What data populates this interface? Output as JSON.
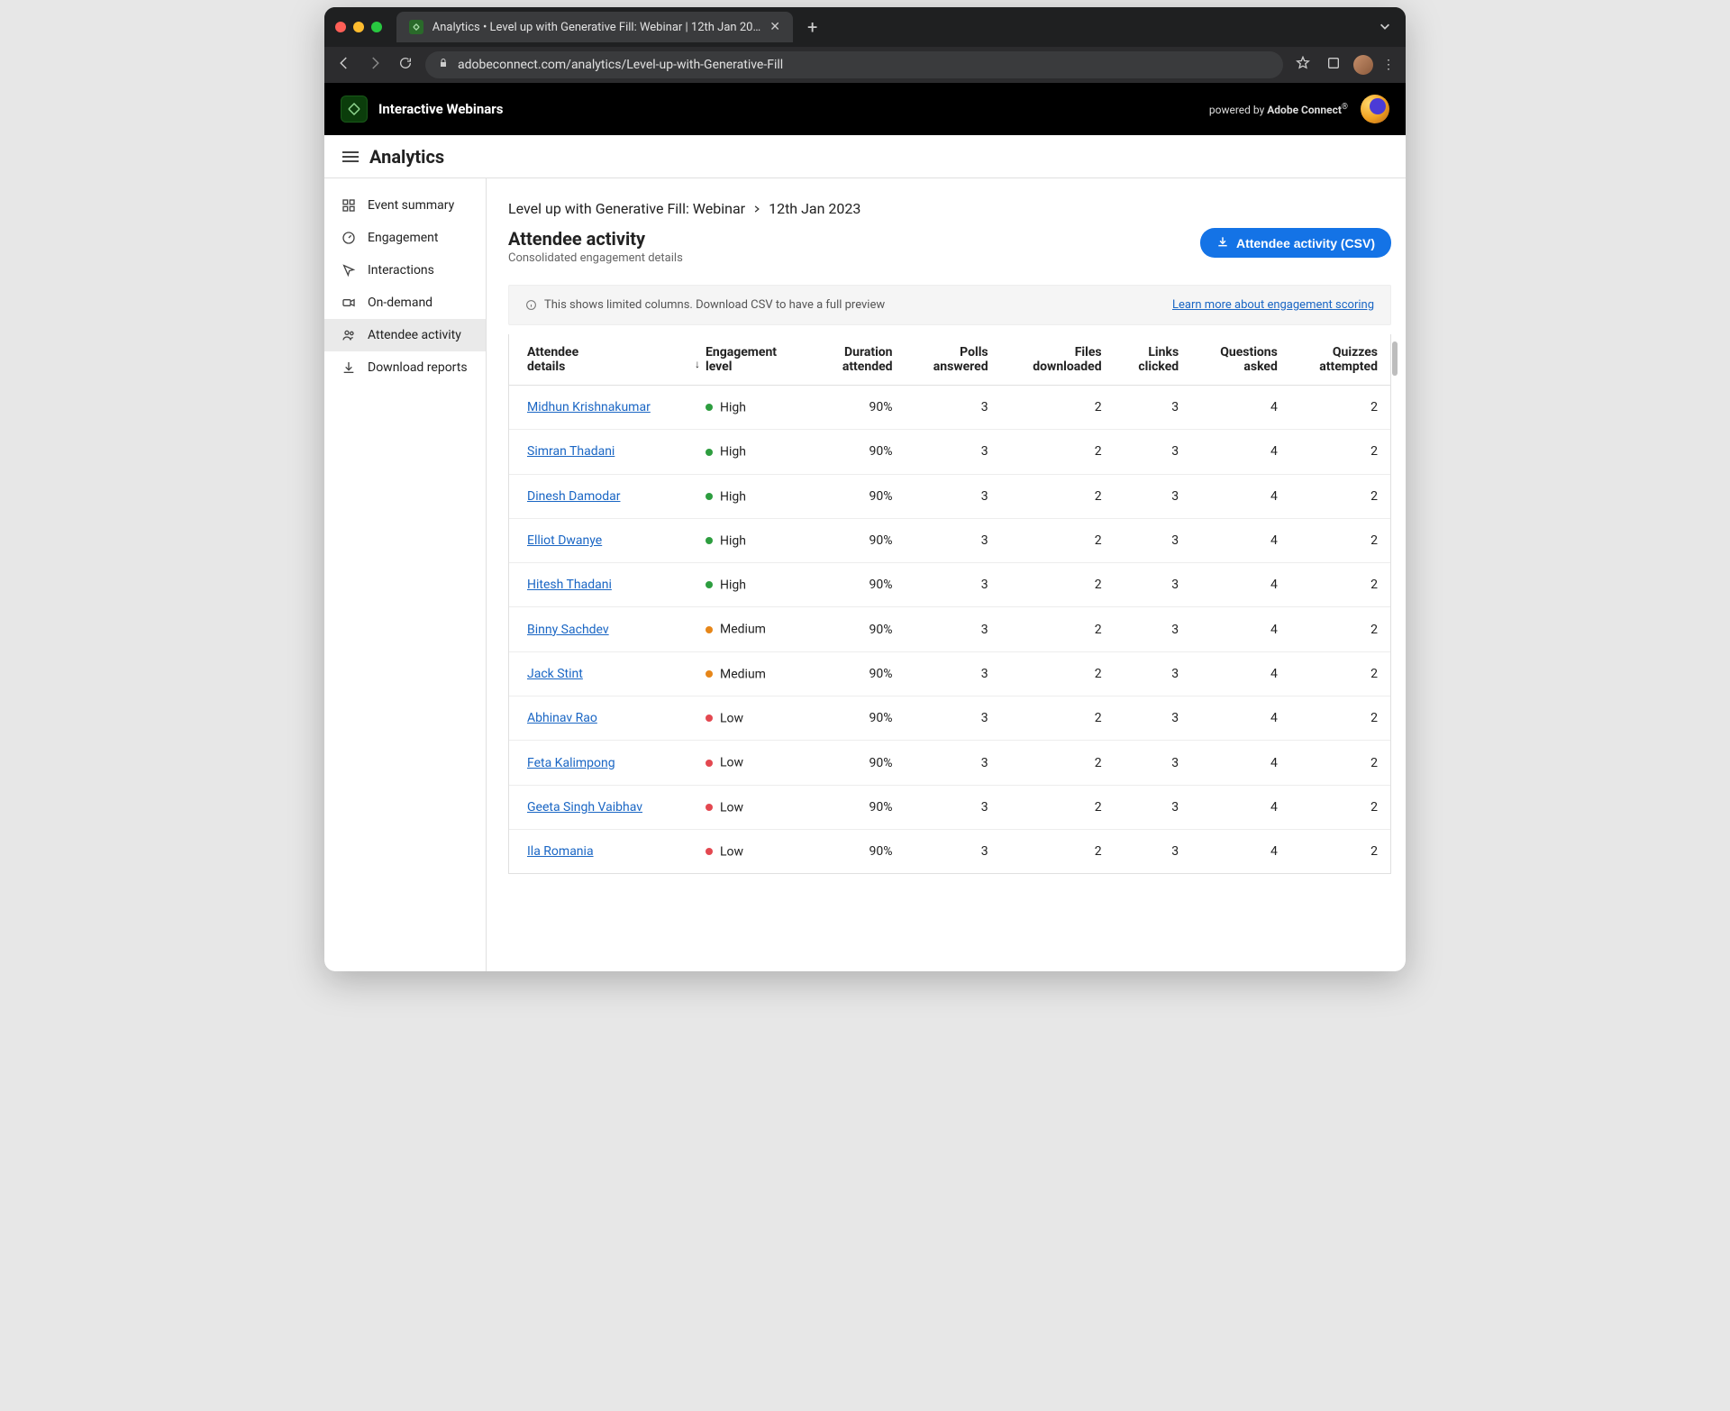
{
  "browser": {
    "tab_title": "Analytics • Level up with Generative Fill: Webinar | 12th Jan 2023",
    "address": "adobeconnect.com/analytics/Level-up-with-Generative-Fill"
  },
  "header": {
    "app_name": "Interactive Webinars",
    "powered_prefix": "powered by ",
    "powered_brand": "Adobe Connect"
  },
  "analytics_bar": {
    "title": "Analytics"
  },
  "sidebar": {
    "items": [
      {
        "id": "event-summary",
        "label": "Event summary"
      },
      {
        "id": "engagement",
        "label": "Engagement"
      },
      {
        "id": "interactions",
        "label": "Interactions"
      },
      {
        "id": "on-demand",
        "label": "On-demand"
      },
      {
        "id": "attendee-activity",
        "label": "Attendee activity"
      },
      {
        "id": "download-reports",
        "label": "Download reports"
      }
    ],
    "active": "attendee-activity"
  },
  "breadcrumb": {
    "event": "Level up with Generative Fill: Webinar",
    "date": "12th Jan 2023"
  },
  "page": {
    "title": "Attendee activity",
    "subtitle": "Consolidated engagement details",
    "csv_button": "Attendee activity (CSV)",
    "banner_text": "This shows limited columns. Download CSV to have a full preview",
    "banner_link": "Learn more about engagement scoring"
  },
  "table": {
    "columns": {
      "attendee": {
        "l1": "Attendee",
        "l2": "details"
      },
      "engagement": {
        "l1": "Engagement",
        "l2": "level"
      },
      "duration": {
        "l1": "Duration",
        "l2": "attended"
      },
      "polls": {
        "l1": "Polls",
        "l2": "answered"
      },
      "files": {
        "l1": "Files",
        "l2": "downloaded"
      },
      "links": {
        "l1": "Links",
        "l2": "clicked"
      },
      "questions": {
        "l1": "Questions",
        "l2": "asked"
      },
      "quizzes": {
        "l1": "Quizzes",
        "l2": "attempted"
      }
    },
    "rows": [
      {
        "name": "Midhun Krishnakumar",
        "level": "High",
        "duration": "90%",
        "polls": "3",
        "files": "2",
        "links": "3",
        "questions": "4",
        "quizzes": "2"
      },
      {
        "name": "Simran Thadani",
        "level": "High",
        "duration": "90%",
        "polls": "3",
        "files": "2",
        "links": "3",
        "questions": "4",
        "quizzes": "2"
      },
      {
        "name": "Dinesh Damodar",
        "level": "High",
        "duration": "90%",
        "polls": "3",
        "files": "2",
        "links": "3",
        "questions": "4",
        "quizzes": "2"
      },
      {
        "name": "Elliot Dwanye",
        "level": "High",
        "duration": "90%",
        "polls": "3",
        "files": "2",
        "links": "3",
        "questions": "4",
        "quizzes": "2"
      },
      {
        "name": "Hitesh Thadani",
        "level": "High",
        "duration": "90%",
        "polls": "3",
        "files": "2",
        "links": "3",
        "questions": "4",
        "quizzes": "2"
      },
      {
        "name": "Binny Sachdev",
        "level": "Medium",
        "duration": "90%",
        "polls": "3",
        "files": "2",
        "links": "3",
        "questions": "4",
        "quizzes": "2"
      },
      {
        "name": "Jack Stint",
        "level": "Medium",
        "duration": "90%",
        "polls": "3",
        "files": "2",
        "links": "3",
        "questions": "4",
        "quizzes": "2"
      },
      {
        "name": "Abhinav Rao",
        "level": "Low",
        "duration": "90%",
        "polls": "3",
        "files": "2",
        "links": "3",
        "questions": "4",
        "quizzes": "2"
      },
      {
        "name": "Feta Kalimpong",
        "level": "Low",
        "duration": "90%",
        "polls": "3",
        "files": "2",
        "links": "3",
        "questions": "4",
        "quizzes": "2"
      },
      {
        "name": "Geeta Singh Vaibhav",
        "level": "Low",
        "duration": "90%",
        "polls": "3",
        "files": "2",
        "links": "3",
        "questions": "4",
        "quizzes": "2"
      },
      {
        "name": "Ila Romania",
        "level": "Low",
        "duration": "90%",
        "polls": "3",
        "files": "2",
        "links": "3",
        "questions": "4",
        "quizzes": "2"
      }
    ]
  }
}
